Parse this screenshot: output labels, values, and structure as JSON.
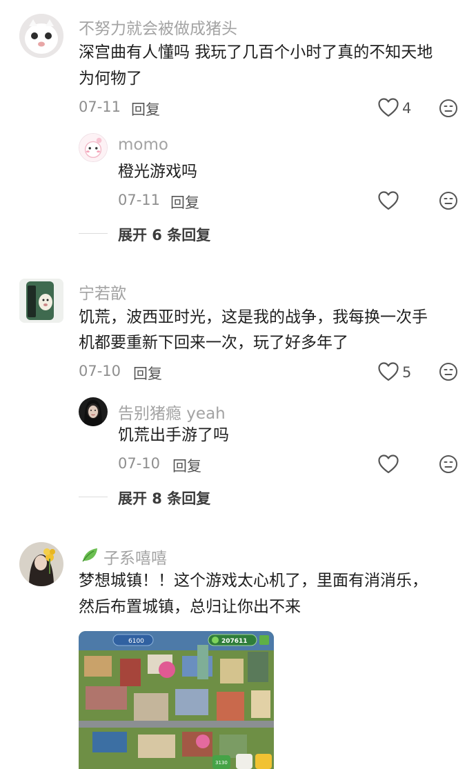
{
  "comments": [
    {
      "username": "不努力就会被做成猪头",
      "text_lines": [
        "深宫曲有人懂吗 我玩了几百个小时了真的不知天地",
        "为何物了"
      ],
      "date": "07-11",
      "reply_label": "回复",
      "likes": "4",
      "replies": [
        {
          "username": "momo",
          "text": "橙光游戏吗",
          "date": "07-11",
          "reply_label": "回复"
        }
      ],
      "expand_label": "展开 6 条回复"
    },
    {
      "username": "宁若歆",
      "text_lines": [
        "饥荒，波西亚时光，这是我的战争，我每换一次手",
        "机都要重新下回来一次，玩了好多年了"
      ],
      "date": "07-10",
      "reply_label": "回复",
      "likes": "5",
      "replies": [
        {
          "username": "告别猪瘾 yeah",
          "text": "饥荒出手游了吗",
          "date": "07-10",
          "reply_label": "回复"
        }
      ],
      "expand_label": "展开 8 条回复"
    },
    {
      "username": "子系嘻嘻",
      "text_lines": [
        "梦想城镇！！这个游戏太心机了，里面有消消乐，",
        "然后布置城镇，总归让你出不来"
      ],
      "image": {
        "hud_left": "6100",
        "hud_right": "207611",
        "badge": "3130"
      }
    }
  ],
  "colors": {
    "username": "#a3a3a3",
    "meta": "#8e8e8e",
    "body": "#1e1e1e",
    "icon": "#555555"
  },
  "icons": [
    "heart-outline-icon",
    "emoji-face-icon",
    "leaf-icon"
  ]
}
